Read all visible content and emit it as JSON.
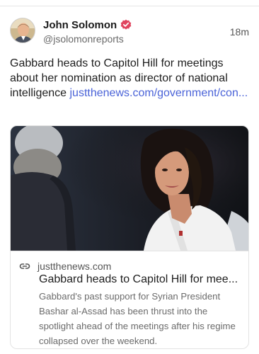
{
  "post": {
    "author_name": "John Solomon",
    "handle": "@jsolomonreports",
    "timestamp": "18m",
    "text": "Gabbard heads to Capitol Hill for meetings about her nomination as director of national intelligence ",
    "link_text": "justthenews.com/government/con...",
    "verified_color": "#e0455f"
  },
  "card": {
    "domain": "justthenews.com",
    "title": "Gabbard heads to Capitol Hill for mee...",
    "description": "Gabbard's past support for Syrian President Bashar al-Assad has been thrust into the spotlight ahead of the meetings after his regime collapsed over the weekend."
  },
  "icons": {
    "verified": "verified-badge-icon",
    "link": "link-icon"
  }
}
